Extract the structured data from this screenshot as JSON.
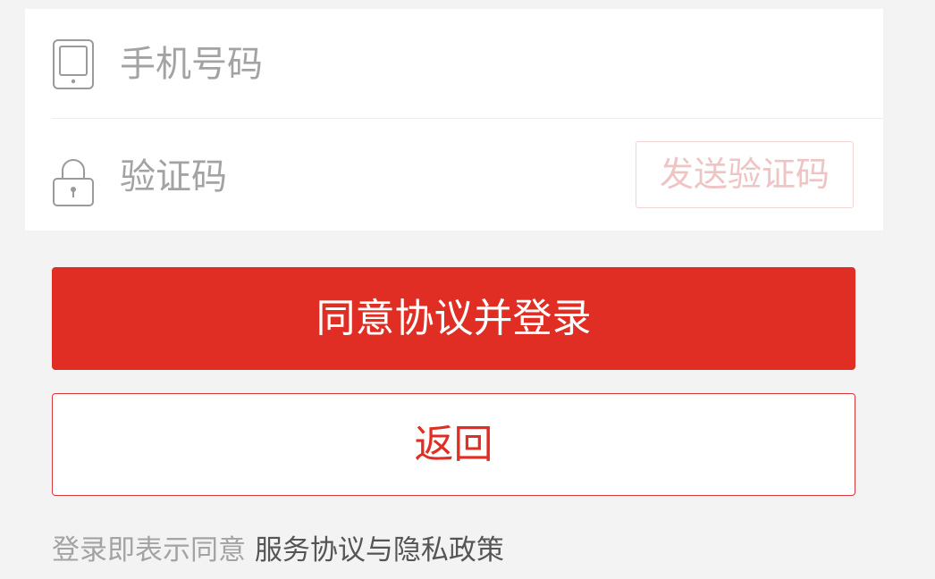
{
  "form": {
    "phone": {
      "icon": "phone-icon",
      "placeholder": "手机号码",
      "value": ""
    },
    "code": {
      "icon": "lock-icon",
      "placeholder": "验证码",
      "value": "",
      "send_label": "发送验证码"
    }
  },
  "actions": {
    "login_label": "同意协议并登录",
    "back_label": "返回"
  },
  "agreement": {
    "prefix": "登录即表示同意",
    "link": "服务协议与隐私政策"
  },
  "colors": {
    "background": "#f3f3f3",
    "primary": "#e02e24",
    "placeholder": "#a3a3a3",
    "send_disabled": "#efc4c4"
  }
}
